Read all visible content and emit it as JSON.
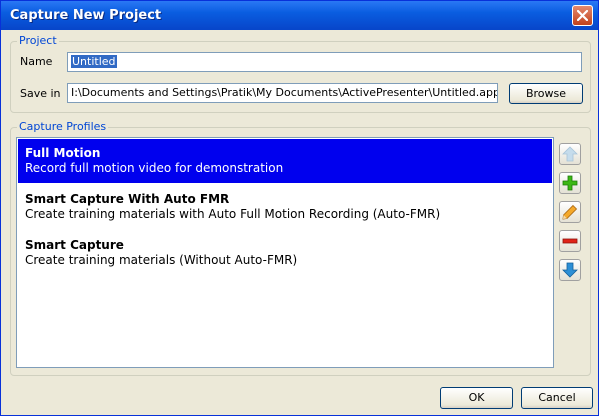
{
  "window": {
    "title": "Capture New Project"
  },
  "project": {
    "legend": "Project",
    "name_label": "Name",
    "name_value": "Untitled",
    "save_label": "Save in",
    "save_value": "I:\\Documents and Settings\\Pratik\\My Documents\\ActivePresenter\\Untitled.approj",
    "browse_label": "Browse"
  },
  "profiles": {
    "legend": "Capture Profiles",
    "items": [
      {
        "name": "Full Motion",
        "desc": "Record full motion video for demonstration",
        "selected": true
      },
      {
        "name": "Smart Capture With Auto FMR",
        "desc": "Create training materials with Auto Full Motion Recording (Auto-FMR)"
      },
      {
        "name": "Smart Capture",
        "desc": "Create training materials (Without Auto-FMR)"
      }
    ],
    "side_buttons": [
      "arrow-up-icon",
      "plus-icon",
      "pencil-icon",
      "minus-icon",
      "arrow-down-icon"
    ]
  },
  "footer": {
    "ok_label": "OK",
    "cancel_label": "Cancel"
  },
  "colors": {
    "title_bar": "#0a5de0",
    "selection": "#0000ee",
    "legend_text": "#0046d5"
  }
}
